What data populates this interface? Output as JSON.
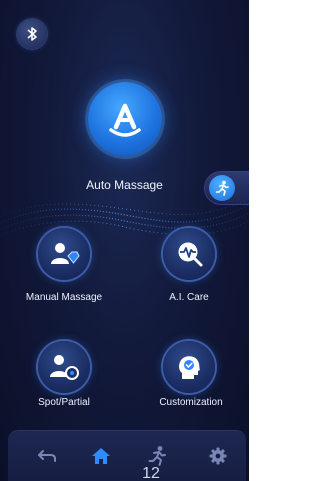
{
  "app": {
    "auto_massage_label": "Auto Massage"
  },
  "features": {
    "manual_massage": "Manual Massage",
    "ai_care": "A.I. Care",
    "spot_partial": "Spot/Partial",
    "customization": "Customization"
  },
  "nav": {
    "active_item": "home",
    "items": [
      "back",
      "home",
      "mode",
      "settings"
    ]
  },
  "page_indicator": "12",
  "icons": {
    "bluetooth": "bluetooth-icon",
    "auto": "letter-a-icon",
    "side_tab": "running-person-icon",
    "manual": "person-diamond-icon",
    "ai": "heartbeat-search-icon",
    "spot": "person-target-icon",
    "custom": "head-check-icon",
    "back": "back-arrow-icon",
    "home": "home-icon",
    "mode": "running-person-icon",
    "settings": "gear-icon"
  },
  "colors": {
    "accent": "#1f74e0",
    "background": "#12193a",
    "active_nav": "#2e8cff",
    "inactive_nav": "#7a86b8"
  }
}
